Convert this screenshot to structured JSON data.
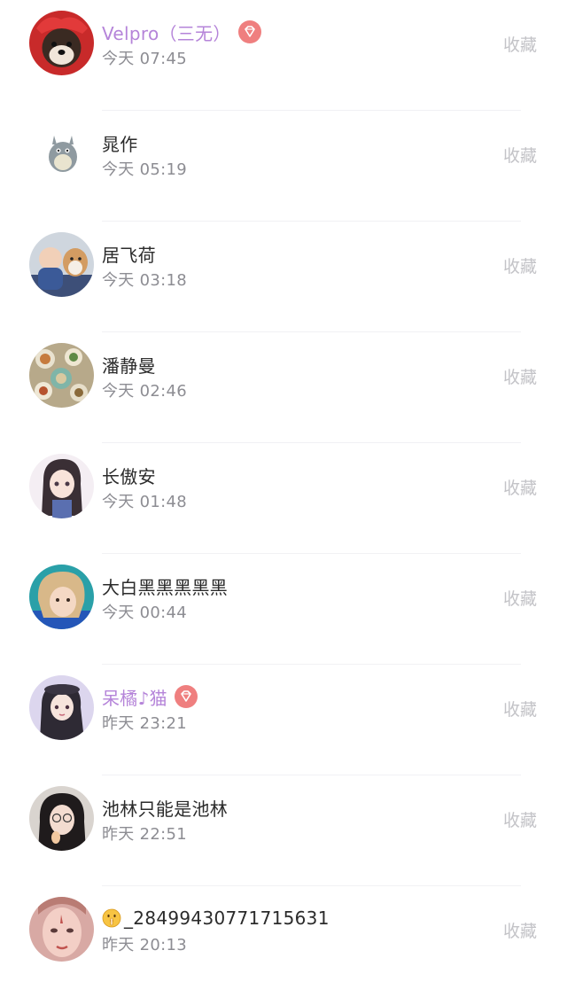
{
  "contacts": [
    {
      "name": "Velpro（三无）",
      "time": "今天 07:45",
      "vip": true,
      "action": "收藏"
    },
    {
      "name": "晁作",
      "time": "今天 05:19",
      "vip": false,
      "action": "收藏"
    },
    {
      "name": "居飞荷",
      "time": "今天 03:18",
      "vip": false,
      "action": "收藏"
    },
    {
      "name": "潘静曼",
      "time": "今天 02:46",
      "vip": false,
      "action": "收藏"
    },
    {
      "name": "长傲安",
      "time": "今天 01:48",
      "vip": false,
      "action": "收藏"
    },
    {
      "name": "大白黑黑黑黑黑",
      "time": "今天 00:44",
      "vip": false,
      "action": "收藏"
    },
    {
      "name": "呆橘♪猫",
      "time": "昨天 23:21",
      "vip": true,
      "action": "收藏"
    },
    {
      "name": "池林只能是池林",
      "time": "昨天 22:51",
      "vip": false,
      "action": "收藏"
    },
    {
      "name": "_28499430771715631",
      "time": "昨天 20:13",
      "vip": false,
      "action": "收藏",
      "prefix_icon": "shushing-face-emoji-icon"
    }
  ],
  "colors": {
    "vip_name": "#b584d9",
    "vip_badge": "#ef7f7f",
    "name": "#2b2b2b",
    "time": "#8d8d93",
    "action": "#c3c3c7"
  }
}
